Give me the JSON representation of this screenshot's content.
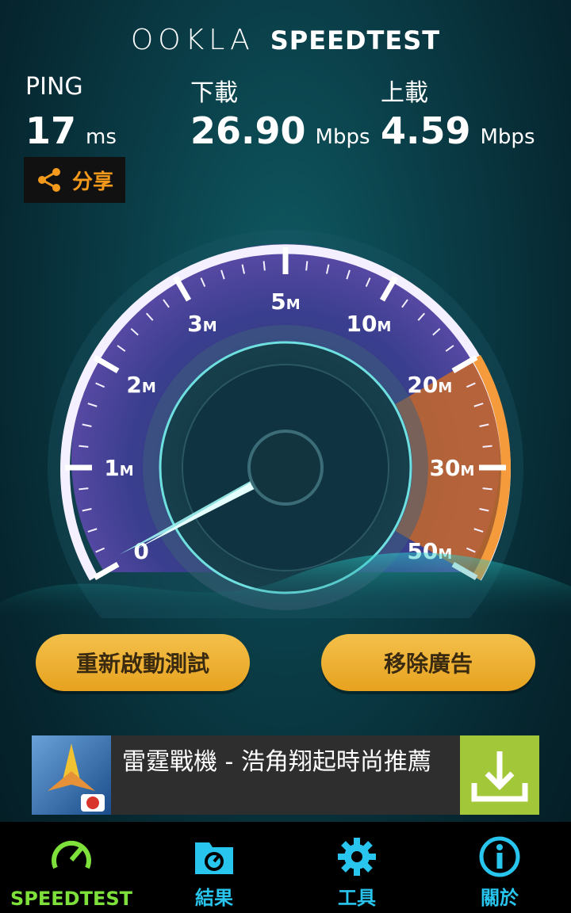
{
  "header": {
    "brand_ookla": "OOKLA",
    "brand_speedtest": "SPEEDTEST"
  },
  "stats": {
    "ping": {
      "label": "PING",
      "value": "17",
      "unit": "ms"
    },
    "download": {
      "label": "下載",
      "value": "26.90",
      "unit": "Mbps"
    },
    "upload": {
      "label": "上載",
      "value": "4.59",
      "unit": "Mbps"
    },
    "share_label": "分享"
  },
  "gauge": {
    "ticks": [
      {
        "num": "0",
        "unit": ""
      },
      {
        "num": "1",
        "unit": "M"
      },
      {
        "num": "2",
        "unit": "M"
      },
      {
        "num": "3",
        "unit": "M"
      },
      {
        "num": "5",
        "unit": "M"
      },
      {
        "num": "10",
        "unit": "M"
      },
      {
        "num": "20",
        "unit": "M"
      },
      {
        "num": "30",
        "unit": "M"
      },
      {
        "num": "50",
        "unit": "M"
      }
    ],
    "needle_value": 0
  },
  "buttons": {
    "retest": "重新啟動測試",
    "remove_ads": "移除廣告"
  },
  "ad": {
    "text": "雷霆戰機 - 浩角翔起時尚推薦"
  },
  "tabs": [
    {
      "label": "SPEEDTEST",
      "color": "#7ee03a",
      "icon": "speedometer-icon"
    },
    {
      "label": "結果",
      "color": "#28c6ee",
      "icon": "results-folder-icon"
    },
    {
      "label": "工具",
      "color": "#28c6ee",
      "icon": "gear-icon"
    },
    {
      "label": "關於",
      "color": "#28c6ee",
      "icon": "info-icon"
    }
  ],
  "colors": {
    "accent_orange": "#f39a1c",
    "gauge_purple": "#a98de6",
    "tab_green": "#7ee03a",
    "tab_blue": "#28c6ee"
  }
}
